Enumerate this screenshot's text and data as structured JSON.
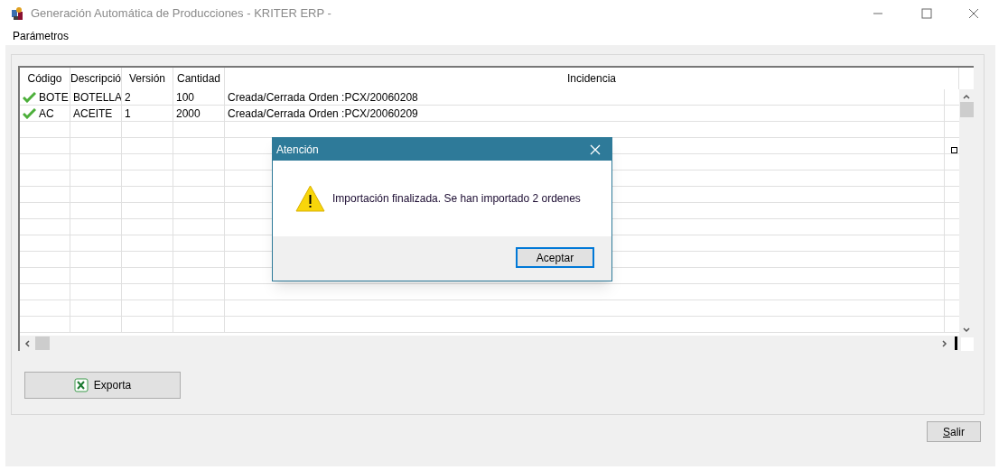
{
  "window": {
    "title": "Generación Automática de Producciones - KRITER ERP -"
  },
  "menu": [
    "Parámetros"
  ],
  "table": {
    "columns": [
      "Código",
      "Descripció",
      "Versión",
      "Cantidad",
      "Incidencia"
    ],
    "rows": [
      {
        "ok": true,
        "cells": [
          "BOTE",
          "BOTELLA",
          "2",
          "100",
          "Creada/Cerrada Orden :PCX/20060208"
        ]
      },
      {
        "ok": true,
        "cells": [
          "AC",
          "ACEITE",
          "1",
          "2000",
          "Creada/Cerrada Orden :PCX/20060209"
        ]
      }
    ]
  },
  "buttons": {
    "export": "Exporta",
    "exit": "Salir"
  },
  "dialog": {
    "title": "Atención",
    "message": "Importación finalizada. Se han importado 2 ordenes",
    "button": "Aceptar"
  }
}
